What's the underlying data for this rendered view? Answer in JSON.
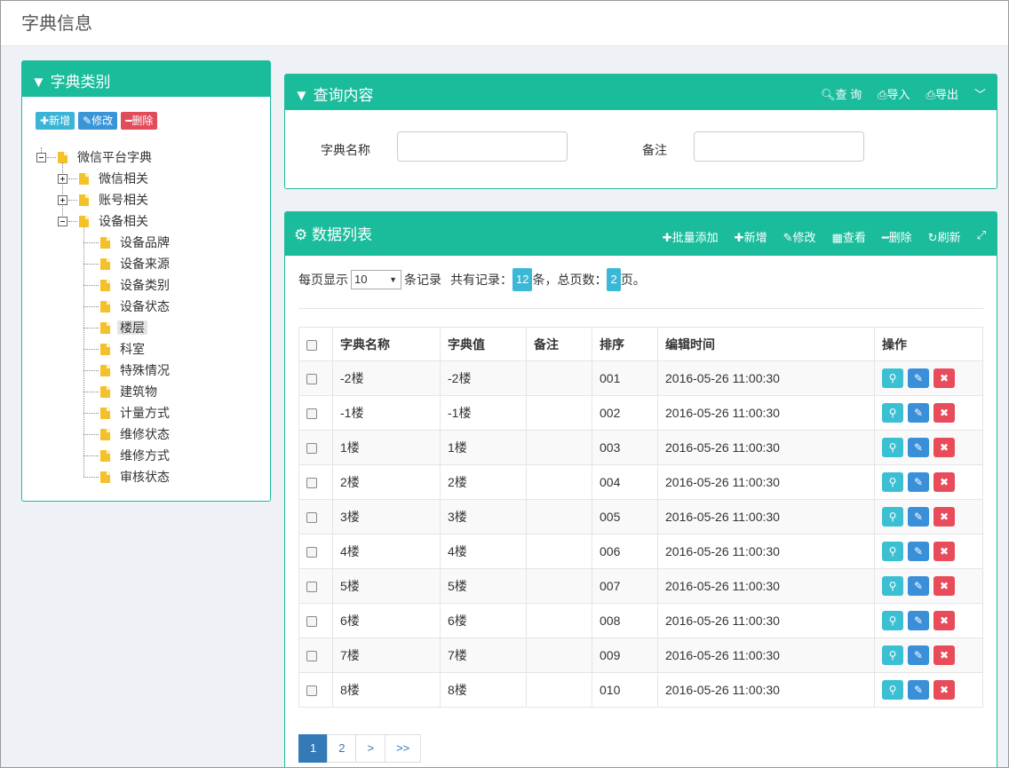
{
  "page": {
    "title": "字典信息"
  },
  "left_panel": {
    "title": "字典类别",
    "buttons": {
      "add": "新增",
      "edit": "修改",
      "delete": "删除"
    },
    "tree": {
      "root": "微信平台字典",
      "children": [
        {
          "label": "微信相关",
          "state": "collapsed"
        },
        {
          "label": "账号相关",
          "state": "collapsed"
        },
        {
          "label": "设备相关",
          "state": "expanded",
          "children": [
            "设备品牌",
            "设备来源",
            "设备类别",
            "设备状态",
            "楼层",
            "科室",
            "特殊情况",
            "建筑物",
            "计量方式",
            "维修状态",
            "维修方式",
            "审核状态"
          ]
        }
      ],
      "selected": "楼层"
    }
  },
  "query_panel": {
    "title": "查询内容",
    "tools": {
      "search": "查 询",
      "import": "导入",
      "export": "导出"
    },
    "fields": {
      "name_label": "字典名称",
      "name_value": "",
      "remark_label": "备注",
      "remark_value": ""
    }
  },
  "data_panel": {
    "title": "数据列表",
    "tools": {
      "batch_add": "批量添加",
      "add": "新增",
      "edit": "修改",
      "view": "查看",
      "delete": "删除",
      "refresh": "刷新"
    },
    "page_info": {
      "prefix": "每页显示",
      "page_size": "10",
      "suffix": "条记录",
      "total_prefix": "共有记录：",
      "total_records": "12",
      "total_mid": "条，总页数：",
      "total_pages": "2",
      "total_suffix": "页。"
    },
    "columns": [
      "字典名称",
      "字典值",
      "备注",
      "排序",
      "编辑时间",
      "操作"
    ],
    "rows": [
      {
        "name": "-2楼",
        "value": "-2楼",
        "remark": "",
        "order": "001",
        "time": "2016-05-26 11:00:30"
      },
      {
        "name": "-1楼",
        "value": "-1楼",
        "remark": "",
        "order": "002",
        "time": "2016-05-26 11:00:30"
      },
      {
        "name": "1楼",
        "value": "1楼",
        "remark": "",
        "order": "003",
        "time": "2016-05-26 11:00:30"
      },
      {
        "name": "2楼",
        "value": "2楼",
        "remark": "",
        "order": "004",
        "time": "2016-05-26 11:00:30"
      },
      {
        "name": "3楼",
        "value": "3楼",
        "remark": "",
        "order": "005",
        "time": "2016-05-26 11:00:30"
      },
      {
        "name": "4楼",
        "value": "4楼",
        "remark": "",
        "order": "006",
        "time": "2016-05-26 11:00:30"
      },
      {
        "name": "5楼",
        "value": "5楼",
        "remark": "",
        "order": "007",
        "time": "2016-05-26 11:00:30"
      },
      {
        "name": "6楼",
        "value": "6楼",
        "remark": "",
        "order": "008",
        "time": "2016-05-26 11:00:30"
      },
      {
        "name": "7楼",
        "value": "7楼",
        "remark": "",
        "order": "009",
        "time": "2016-05-26 11:00:30"
      },
      {
        "name": "8楼",
        "value": "8楼",
        "remark": "",
        "order": "010",
        "time": "2016-05-26 11:00:30"
      }
    ],
    "pager": [
      "1",
      "2",
      ">",
      ">>"
    ],
    "pager_active": "1"
  },
  "colors": {
    "accent": "#1abc9c",
    "info": "#3bc0d3",
    "primary": "#3a8fd9",
    "danger": "#e84c5a",
    "pager_active": "#337ab7"
  }
}
